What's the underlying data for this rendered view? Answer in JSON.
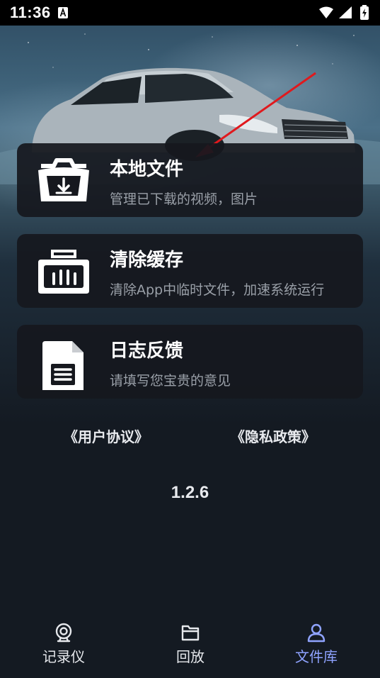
{
  "status_bar": {
    "time": "11:36",
    "notification_icon": "a-notification-icon",
    "icons": [
      "wifi-icon",
      "cellular-signal-icon",
      "battery-icon"
    ]
  },
  "cards": [
    {
      "title": "本地文件",
      "subtitle": "管理已下载的视频，图片",
      "icon": "folder-download-icon"
    },
    {
      "title": "清除缓存",
      "subtitle": "清除App中临时文件，加速系统运行",
      "icon": "clear-cache-icon"
    },
    {
      "title": "日志反馈",
      "subtitle": "请填写您宝贵的意见",
      "icon": "document-icon"
    }
  ],
  "links": {
    "user_agreement": "《用户协议》",
    "privacy_policy": "《隐私政策》"
  },
  "version": "1.2.6",
  "bottom_nav": {
    "active": "文件库",
    "items": [
      {
        "label": "记录仪",
        "icon": "camera-icon"
      },
      {
        "label": "回放",
        "icon": "folder-icon"
      },
      {
        "label": "文件库",
        "icon": "user-icon"
      }
    ]
  },
  "colors": {
    "accent": "#8fa3ff",
    "card_bg": "#16181e",
    "arrow": "#e0191d"
  }
}
